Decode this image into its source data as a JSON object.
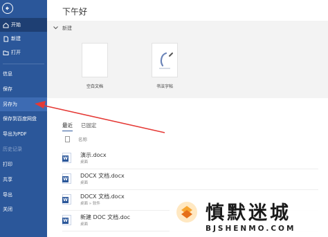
{
  "sidebar": {
    "items": [
      {
        "label": "开始",
        "icon": "home-icon"
      },
      {
        "label": "新建",
        "icon": "new-doc-icon"
      },
      {
        "label": "打开",
        "icon": "folder-open-icon"
      },
      {
        "label": "信息"
      },
      {
        "label": "保存"
      },
      {
        "label": "另存为"
      },
      {
        "label": "保存到百度网盘"
      },
      {
        "label": "导出为PDF"
      },
      {
        "label": "历史记录"
      },
      {
        "label": "打印"
      },
      {
        "label": "共享"
      },
      {
        "label": "导出"
      },
      {
        "label": "关闭"
      }
    ]
  },
  "main": {
    "greeting": "下午好",
    "new_section": {
      "title": "新建",
      "templates": [
        {
          "label": "空白文档"
        },
        {
          "label": "书法字帖"
        }
      ]
    },
    "tabs": [
      {
        "label": "最近"
      },
      {
        "label": "已固定"
      }
    ],
    "column_header": "名称",
    "files": [
      {
        "name": "演示.docx",
        "path": "桌面"
      },
      {
        "name": "DOCX 文档.docx",
        "path": "桌面"
      },
      {
        "name": "DOCX 文档.docx",
        "path": "桌面 » 软件"
      },
      {
        "name": "新建 DOC 文档.doc",
        "path": "桌面"
      }
    ]
  },
  "watermark": {
    "title": "慎默迷城",
    "subtitle": "BJSHENMO.COM"
  },
  "colors": {
    "sidebar": "#2b579a",
    "sidebar_active": "#1e3f73",
    "arrow": "#e53935"
  }
}
